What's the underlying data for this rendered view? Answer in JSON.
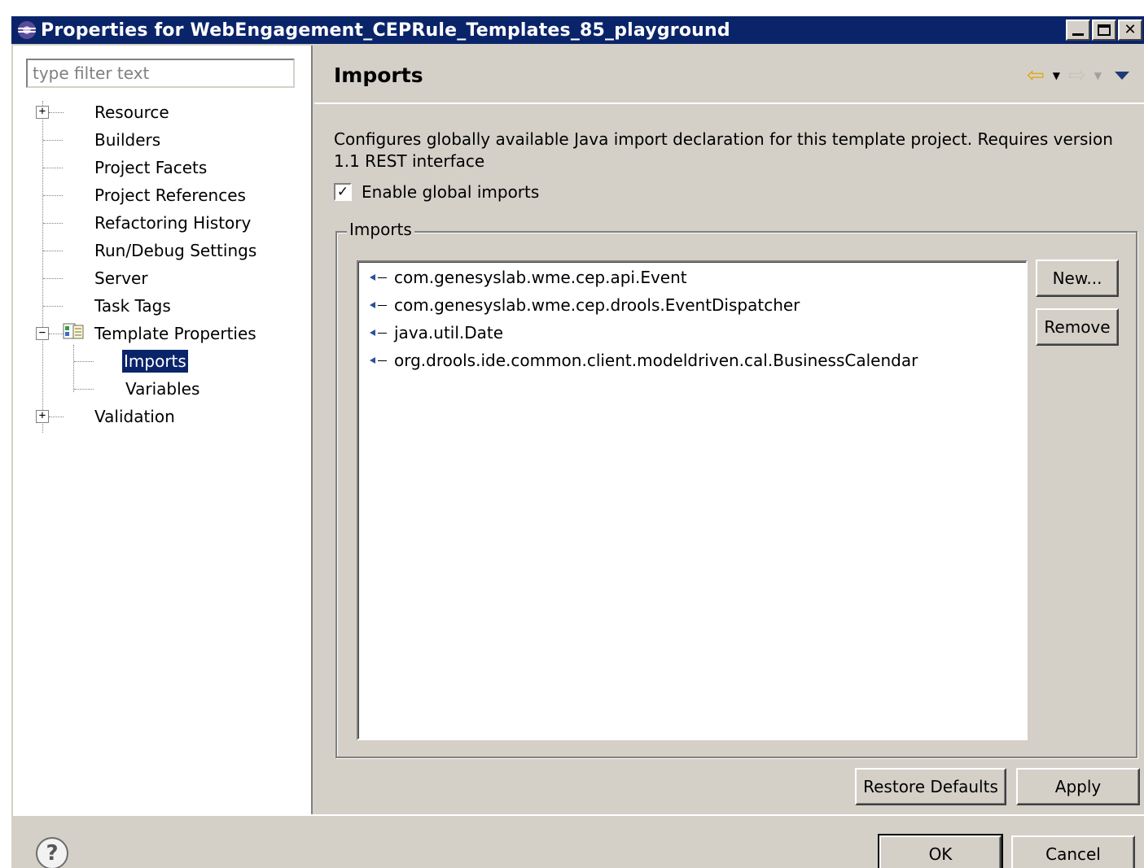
{
  "window": {
    "title": "Properties for WebEngagement_CEPRule_Templates_85_playground"
  },
  "left": {
    "filter_placeholder": "type filter text",
    "tree": {
      "resource": "Resource",
      "builders": "Builders",
      "project_facets": "Project Facets",
      "project_references": "Project References",
      "refactoring_history": "Refactoring History",
      "run_debug_settings": "Run/Debug Settings",
      "server": "Server",
      "task_tags": "Task Tags",
      "template_properties": "Template Properties",
      "imports": "Imports",
      "variables": "Variables",
      "validation": "Validation"
    }
  },
  "page": {
    "title": "Imports",
    "description": "Configures globally available Java import declaration for this template project.  Requires version 1.1 REST interface",
    "enable_label": "Enable global imports",
    "enable_checked": true,
    "group_title": "Imports",
    "imports": [
      "com.genesyslab.wme.cep.api.Event",
      "com.genesyslab.wme.cep.drools.EventDispatcher",
      "java.util.Date",
      "org.drools.ide.common.client.modeldriven.cal.BusinessCalendar"
    ],
    "new_label": "New...",
    "remove_label": "Remove",
    "restore_label": "Restore Defaults",
    "apply_label": "Apply"
  },
  "footer": {
    "ok_label": "OK",
    "cancel_label": "Cancel"
  }
}
